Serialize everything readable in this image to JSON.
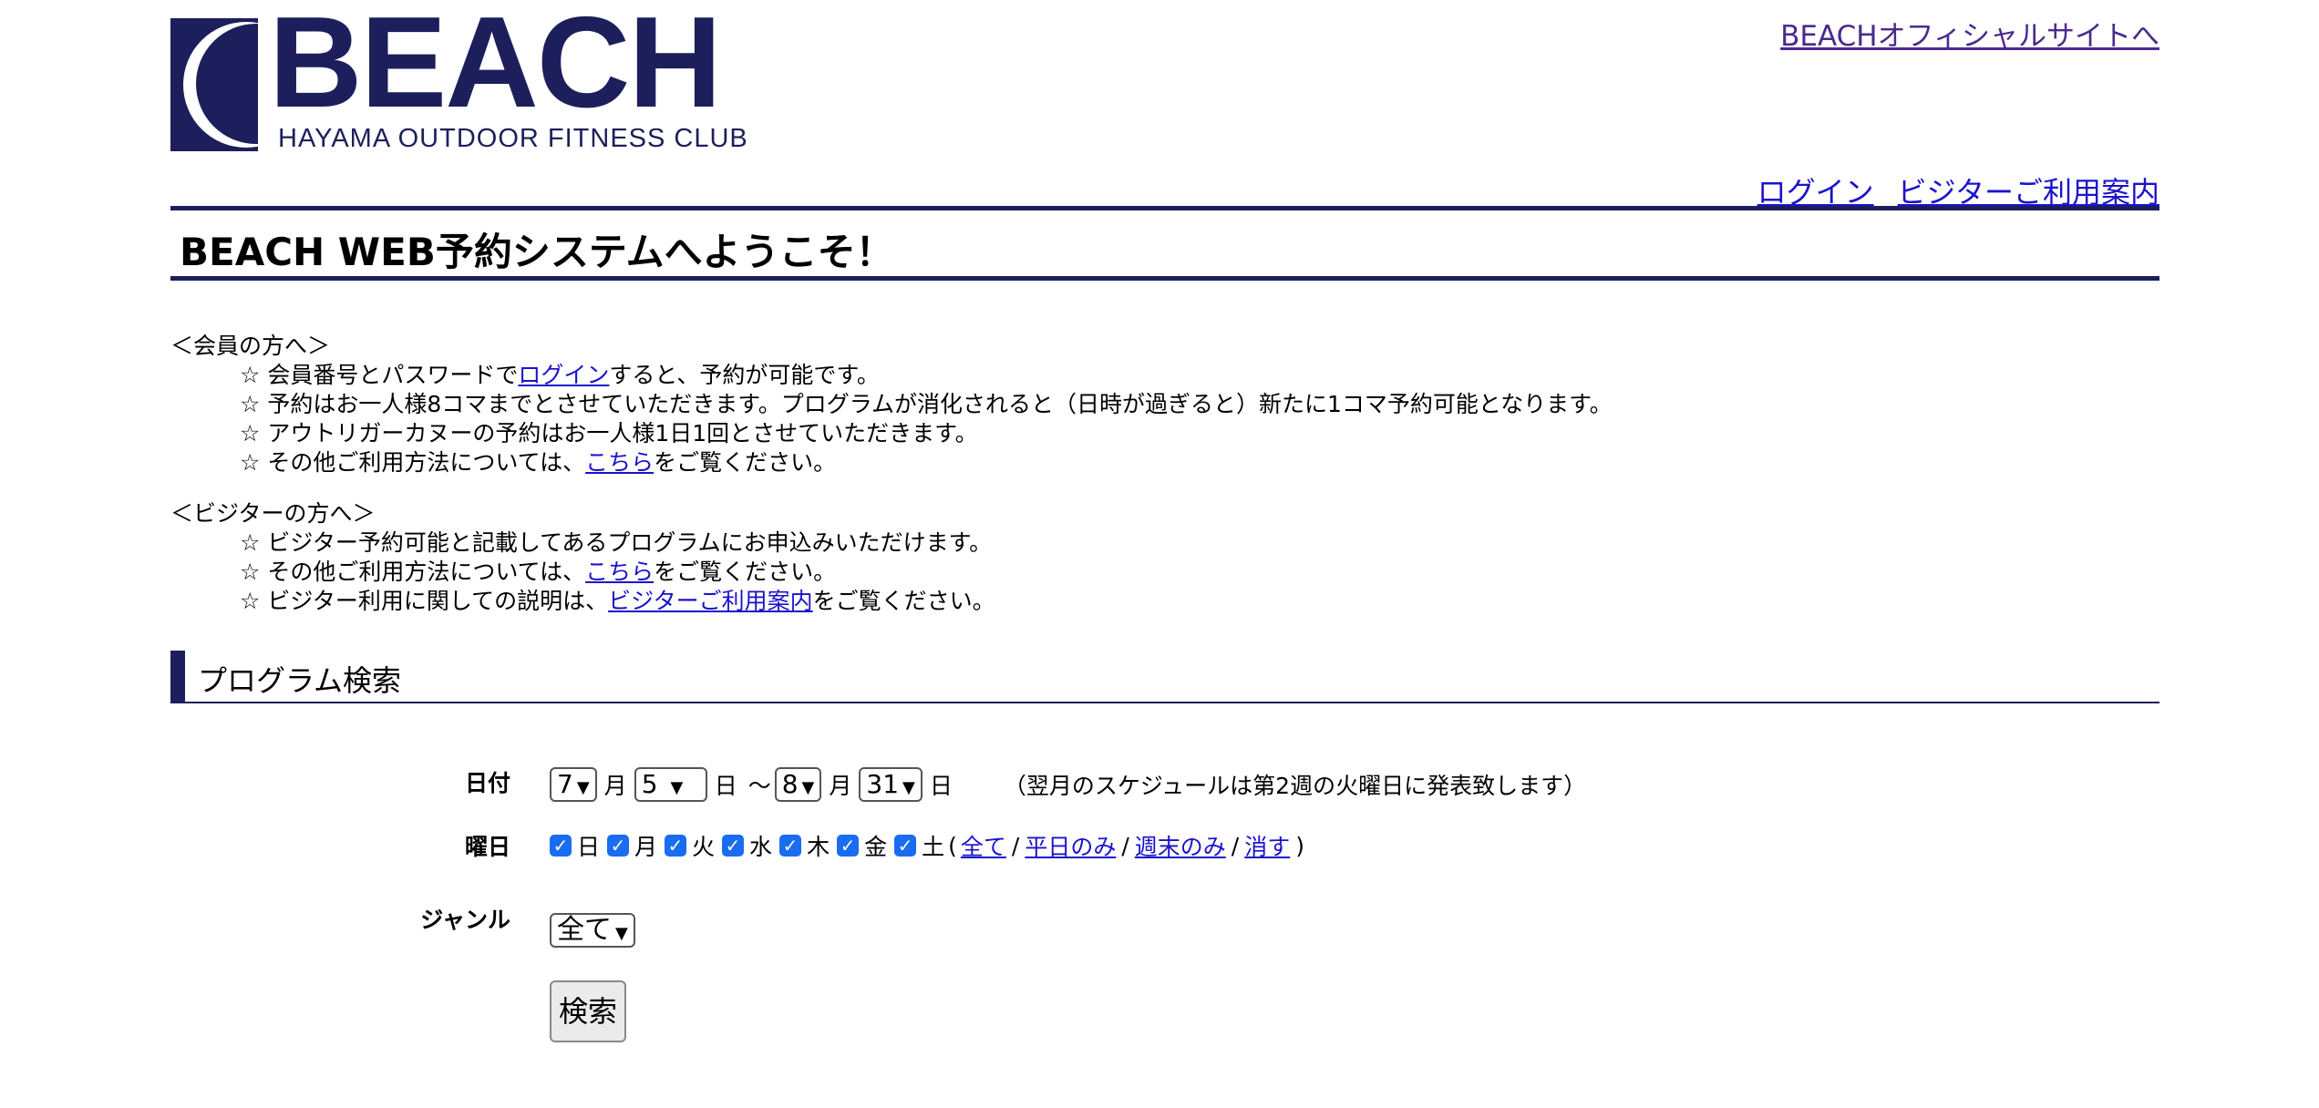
{
  "header": {
    "logo_text": "BEACH",
    "logo_subtitle": "HAYAMA OUTDOOR FITNESS CLUB",
    "official_link": "BEACHオフィシャルサイトへ",
    "login_link": "ログイン",
    "visitor_guide_link": "ビジターご利用案内"
  },
  "title": "BEACH WEB予約システムへようこそ！",
  "members": {
    "heading": "＜会員の方へ＞",
    "line1_pre": "☆ 会員番号とパスワードで",
    "line1_link": "ログイン",
    "line1_post": "すると、予約が可能です。",
    "line2": "☆ 予約はお一人様8コマまでとさせていただきます。プログラムが消化されると（日時が過ぎると）新たに1コマ予約可能となります。",
    "line3": "☆ アウトリガーカヌーの予約はお一人様1日1回とさせていただきます。",
    "line4_pre": "☆ その他ご利用方法については、",
    "line4_link": "こちら",
    "line4_post": "をご覧ください。"
  },
  "visitors": {
    "heading": "＜ビジターの方へ＞",
    "line1": "☆ ビジター予約可能と記載してあるプログラムにお申込みいただけます。",
    "line2_pre": "☆ その他ご利用方法については、",
    "line2_link": "こちら",
    "line2_post": "をご覧ください。",
    "line3_pre": "☆ ビジター利用に関しての説明は、",
    "line3_link": "ビジターご利用案内",
    "line3_post": "をご覧ください。"
  },
  "search": {
    "section_title": "プログラム検索",
    "date_label": "日付",
    "from_month": "7",
    "from_day": "5",
    "to_month": "8",
    "to_day": "31",
    "month_unit": "月",
    "day_unit": "日",
    "range_sep": "～",
    "date_note": "（翌月のスケジュールは第2週の火曜日に発表致します）",
    "weekday_label": "曜日",
    "weekdays": [
      "日",
      "月",
      "火",
      "水",
      "木",
      "金",
      "土"
    ],
    "weekdays_checked": [
      true,
      true,
      true,
      true,
      true,
      true,
      true
    ],
    "paren_open": "(",
    "paren_close": ")",
    "sep": "/",
    "link_all": "全て",
    "link_weekday": "平日のみ",
    "link_weekend": "週末のみ",
    "link_clear": "消す",
    "genre_label": "ジャンル",
    "genre_value": "全て",
    "search_button": "検索"
  }
}
